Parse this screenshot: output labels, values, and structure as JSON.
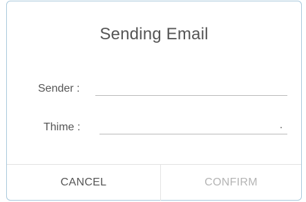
{
  "dialog": {
    "title": "Sending Email",
    "fields": {
      "sender": {
        "label": "Sender :",
        "value": ""
      },
      "time": {
        "label": "Thime :",
        "value": ""
      }
    },
    "buttons": {
      "cancel": "CANCEL",
      "confirm": "CONFIRM"
    }
  },
  "colors": {
    "border": "#a8c8dc",
    "text": "#555555",
    "disabled_text": "#b4b4b4",
    "divider": "#e2e2e2"
  }
}
